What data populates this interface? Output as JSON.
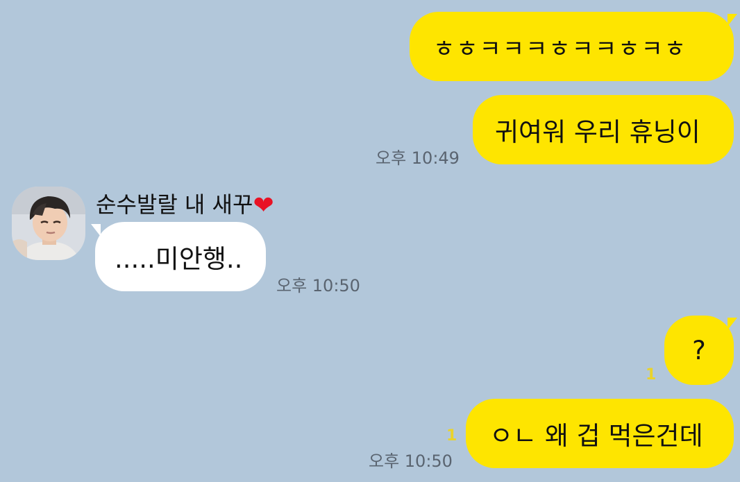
{
  "chat": {
    "messages": [
      {
        "side": "mine",
        "text": "ㅎㅎㅋㅋㅋㅎㅋㅋㅎㅋㅎ"
      },
      {
        "side": "mine",
        "text": "귀여워 우리 휴닝이",
        "time": "오후 10:49"
      },
      {
        "side": "theirs",
        "sender": "순수발랄 내 새꾸",
        "sender_emoji": "❤",
        "text": ".....미안행..",
        "time": "오후 10:50"
      },
      {
        "side": "mine",
        "text": "?",
        "unread": "1"
      },
      {
        "side": "mine",
        "text": "ㅇㄴ 왜 겁 먹은건데",
        "unread": "1",
        "time": "오후 10:50"
      }
    ]
  },
  "colors": {
    "background": "#b2c7da",
    "my_bubble": "#fee500",
    "their_bubble": "#ffffff",
    "unread_count": "#e9d32c"
  },
  "icons": {
    "avatar": "profile-photo"
  }
}
